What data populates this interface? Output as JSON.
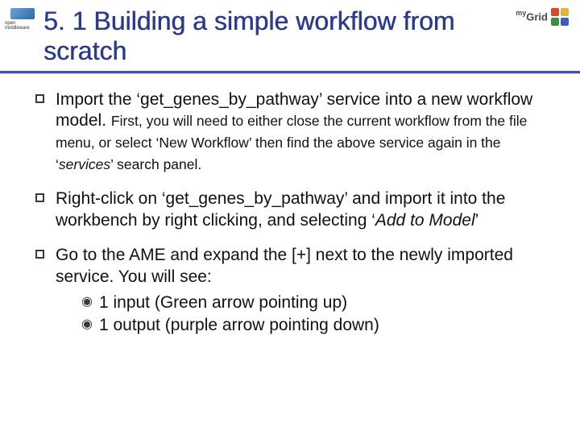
{
  "header": {
    "left_logo_alt": "OMII-UK logo",
    "right_brand_prefix": "my",
    "right_brand_main": "Grid",
    "title": "5. 1 Building a simple workflow from scratch"
  },
  "bullets": [
    {
      "lead": "Import the ‘get_genes_by_pathway’ service into a new workflow model. ",
      "tail_small": "First, you will need to either close the current workflow from the file menu, or select ‘New Workflow’ then find the above service again in the ‘",
      "tail_small_em": "services",
      "tail_small_after": "’ search panel."
    },
    {
      "lead_a": "Right-click on ‘get_genes_by_pathway’ and import it into the workbench by right clicking, and selecting ‘",
      "lead_em": "Add to Model",
      "lead_b": "’"
    },
    {
      "lead": "Go to the AME and expand the [+] next to the newly imported service. You will see:",
      "subs": [
        "1 input (Green arrow pointing up)",
        "1 output (purple arrow pointing down)"
      ]
    }
  ]
}
